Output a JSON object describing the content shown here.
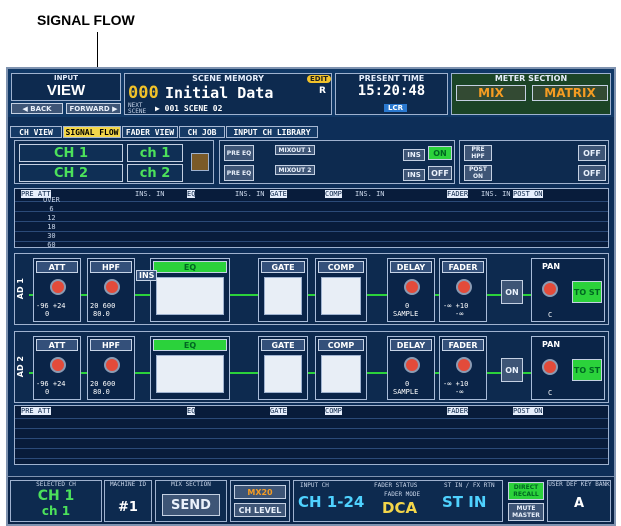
{
  "callout": {
    "label": "SIGNAL FLOW"
  },
  "topbar": {
    "input_label": "INPUT",
    "view_label": "VIEW",
    "back_label": "◀ BACK",
    "forward_label": "FORWARD ▶",
    "scene_memory_label": "SCENE MEMORY",
    "edit_badge": "EDIT",
    "scene_number": "000",
    "scene_title": "Initial Data",
    "scene_r": "R",
    "next_label": "NEXT SCENE",
    "next_scene": "▶ 001 SCENE 02",
    "present_time_label": "PRESENT TIME",
    "present_time": "15:20:48",
    "lcr_label": "LCR",
    "meter_section_label": "METER SECTION",
    "mix_label": "MIX",
    "matrix_label": "MATRIX"
  },
  "tabs": [
    "CH VIEW",
    "SIGNAL FLOW",
    "FADER VIEW",
    "CH JOB",
    "INPUT CH LIBRARY"
  ],
  "channel_select": {
    "ch1": "CH 1",
    "ch1_name": "ch 1",
    "ch2": "CH 2",
    "ch2_name": "ch 2"
  },
  "routing": {
    "pre_eq": "PRE EQ",
    "ins": "INS",
    "mixout1": "MIXOUT 1",
    "mixout2": "MIXOUT 2",
    "on": "ON",
    "off": "OFF",
    "pre_hpf": "PRE HPF",
    "post_on": "POST ON"
  },
  "meter_labels": [
    "PRE ATT",
    "INS. IN",
    "EQ",
    "INS. IN",
    "GATE",
    "COMP",
    "INS. IN",
    "FADER",
    "INS. IN",
    "POST ON"
  ],
  "meter_scale": [
    "OVER",
    "6",
    "12",
    "18",
    "30",
    "60"
  ],
  "strips": [
    {
      "id": "AD 1",
      "att": "ATT",
      "att_range": "-96 +24",
      "att_value": "0",
      "att_unit": "dB",
      "hpf": "HPF",
      "hpf_range": "20 600",
      "hpf_value": "80.0",
      "hpf_unit": "Hz",
      "ins": "INS",
      "eq": "EQ",
      "gate": "GATE",
      "comp": "COMP",
      "delay": "DELAY",
      "delay_value": "0",
      "delay_unit": "SAMPLE",
      "fader": "FADER",
      "fader_value": "-∞",
      "fader_range": "-∞ +10",
      "on": "ON",
      "pan": "PAN",
      "pan_value": "C",
      "to_st": "TO ST"
    },
    {
      "id": "AD 2",
      "att": "ATT",
      "att_range": "-96 +24",
      "att_value": "0",
      "att_unit": "dB",
      "hpf": "HPF",
      "hpf_range": "20 600",
      "hpf_value": "80.0",
      "hpf_unit": "Hz",
      "ins": "",
      "eq": "EQ",
      "gate": "GATE",
      "comp": "COMP",
      "delay": "DELAY",
      "delay_value": "0",
      "delay_unit": "SAMPLE",
      "fader": "FADER",
      "fader_value": "-∞",
      "fader_range": "-∞ +10",
      "on": "ON",
      "pan": "PAN",
      "pan_value": "C",
      "to_st": "TO ST"
    }
  ],
  "bottombar": {
    "selected_ch_label": "SELECTED CH",
    "selected_ch": "CH 1",
    "selected_name": "ch 1",
    "machine_id_label": "MACHINE ID",
    "machine_id": "#1",
    "mix_section_label": "MIX SECTION",
    "send": "SEND",
    "mix20": "MX20",
    "ch_level": "CH LEVEL",
    "input_ch_label": "INPUT CH",
    "input_ch_value": "CH 1-24",
    "fader_status_label": "FADER STATUS",
    "fader_mode_label": "FADER MODE",
    "fader_mode": "DCA",
    "st_in_label": "ST IN / FX RTN",
    "st_in_value": "ST IN",
    "direct_recall": "DIRECT RECALL",
    "mute_master": "MUTE MASTER",
    "user_def_label": "USER DEF KEY BANK",
    "user_def_value": "A"
  }
}
